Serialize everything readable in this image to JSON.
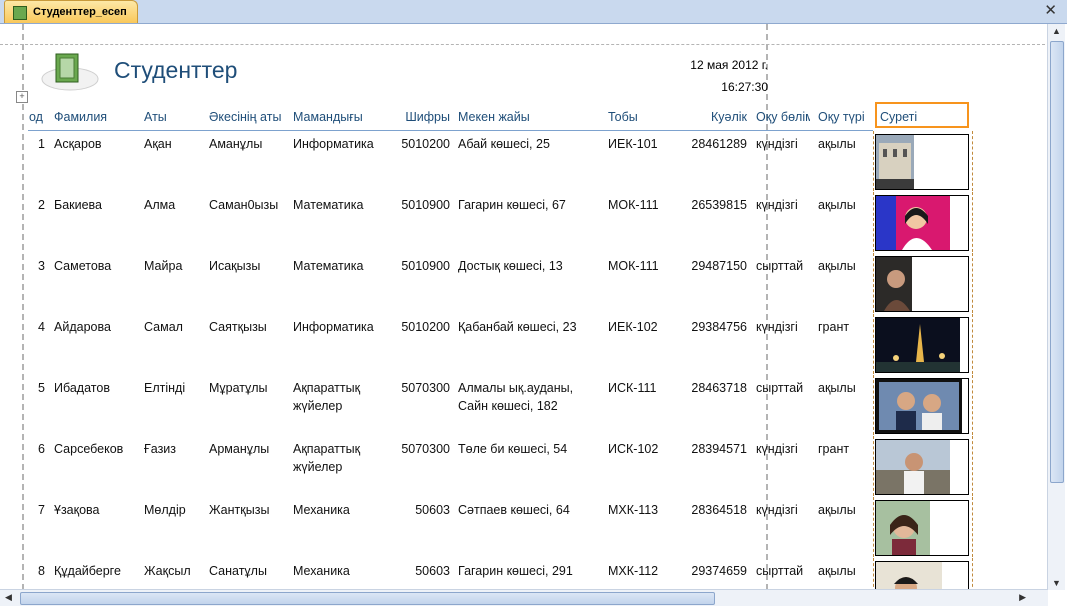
{
  "tab": {
    "label": "Студенттер_есеп"
  },
  "report": {
    "title": "Студенттер",
    "date": "12 мая 2012 г.",
    "time": "16:27:30"
  },
  "columns": [
    "од",
    "Фамилия",
    "Аты",
    "Әкесінің аты",
    "Мамандығы",
    "Шифры",
    "Мекен жайы",
    "Тобы",
    "Куәлік",
    "Оқу бөлімі",
    "Оқу түрі",
    "Суреті"
  ],
  "rows": [
    {
      "code": "1",
      "surname": "Асқаров",
      "name": "Ақан",
      "patronymic": "Аманұлы",
      "specialty": "Информатика",
      "cipher": "5010200",
      "address": "Абай көшесі, 25",
      "group": "ИЕК-101",
      "id_number": "28461289",
      "dept": "күндізгі",
      "study_type": "ақылы",
      "photo": "building"
    },
    {
      "code": "2",
      "surname": "Бакиева",
      "name": "Алма",
      "patronymic": "Саман0ызы",
      "specialty": "Математика",
      "cipher": "5010900",
      "address": "Гагарин көшесі, 67",
      "group": "МОК-111",
      "id_number": "26539815",
      "dept": "күндізгі",
      "study_type": "ақылы",
      "photo": "portrait-colorful"
    },
    {
      "code": "3",
      "surname": "Саметова",
      "name": "Майра",
      "patronymic": "Исақызы",
      "specialty": "Математика",
      "cipher": "5010900",
      "address": "Достық көшесі, 13",
      "group": "МОК-111",
      "id_number": "29487150",
      "dept": "сырттай",
      "study_type": "ақылы",
      "photo": "portrait-dark"
    },
    {
      "code": "4",
      "surname": "Айдарова",
      "name": "Самал",
      "patronymic": "Саятқызы",
      "specialty": "Информатика",
      "cipher": "5010200",
      "address": "Қабанбай көшесі, 23",
      "group": "ИЕК-102",
      "id_number": "29384756",
      "dept": "күндізгі",
      "study_type": "грант",
      "photo": "night-city"
    },
    {
      "code": "5",
      "surname": "Ибадатов",
      "name": "Елтінді",
      "patronymic": "Мұратұлы",
      "specialty": "Ақпараттық жүйелер",
      "cipher": "5070300",
      "address": "Алмалы ық.ауданы, Сайн көшесі, 182",
      "group": "ИСК-111",
      "id_number": "28463718",
      "dept": "сырттай",
      "study_type": "ақылы",
      "photo": "two-people"
    },
    {
      "code": "6",
      "surname": "Сарсебеков",
      "name": "Ғазиз",
      "patronymic": "Арманұлы",
      "specialty": "Ақпараттық жүйелер",
      "cipher": "5070300",
      "address": "Төле би көшесі, 54",
      "group": "ИСК-102",
      "id_number": "28394571",
      "dept": "күндізгі",
      "study_type": "грант",
      "photo": "street"
    },
    {
      "code": "7",
      "surname": "Ұзақова",
      "name": "Мөлдір",
      "patronymic": "Жантқызы",
      "specialty": "Механика",
      "cipher": "50603",
      "address": "Сәтпаев көшесі, 64",
      "group": "МХК-113",
      "id_number": "28364518",
      "dept": "күндізгі",
      "study_type": "ақылы",
      "photo": "smiling-woman"
    },
    {
      "code": "8",
      "surname": "Құдайберге",
      "name": "Жақсыл",
      "patronymic": "Санатұлы",
      "specialty": "Механика",
      "cipher": "50603",
      "address": "Гагарин көшесі, 291",
      "group": "МХК-112",
      "id_number": "29374659",
      "dept": "сырттай",
      "study_type": "ақылы",
      "photo": "young-man"
    }
  ],
  "icons": {
    "tab": "report-icon",
    "logo": "report-book-icon",
    "close": "close-icon"
  }
}
